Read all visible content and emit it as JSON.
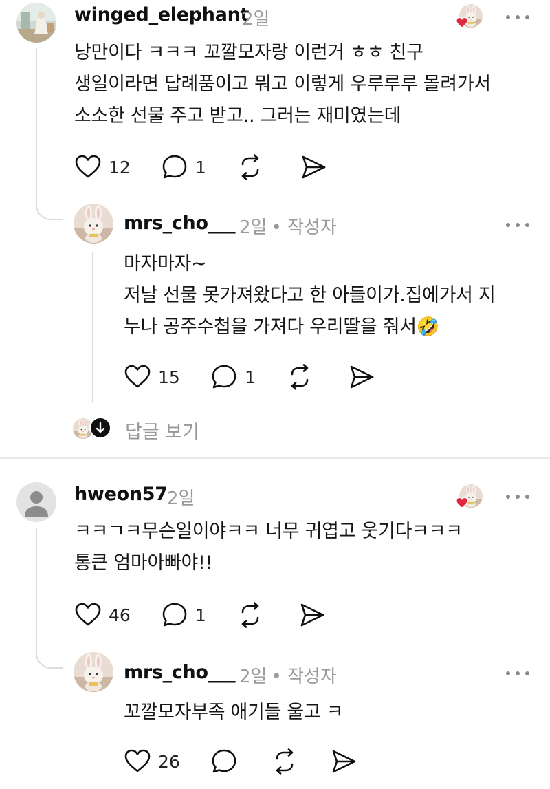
{
  "comments": [
    {
      "username": "winged_elephant",
      "time": "2일",
      "lines": [
        "낭만이다 ㅋㅋㅋ 꼬깔모자랑 이런거 ㅎㅎ 친구",
        "생일이라면 답례품이고 뭐고 이렇게 우루루루 몰려가서",
        "소소한 선물 주고 받고.. 그러는 재미였는데"
      ],
      "likes": "12",
      "replies": "1",
      "reply": {
        "username": "mrs_cho___",
        "time": "2일",
        "author_tag": "• 작성자",
        "lines": [
          "마자마자~",
          "저날 선물 못가져왔다고 한 아들이가.집에가서 지",
          "누나 공주수첩을 가져다 우리딸을 줘서🤣"
        ],
        "likes": "15",
        "replies": "1"
      },
      "view_replies": "답글 보기"
    },
    {
      "username": "hweon57",
      "time": "2일",
      "lines": [
        "ㅋㅋㄱㅋ무슨일이야ㅋㅋ 너무 귀엽고 웃기다ㅋㅋㅋ",
        "통큰 엄마아빠야!!"
      ],
      "likes": "46",
      "replies": "1",
      "reply": {
        "username": "mrs_cho___",
        "time": "2일",
        "author_tag": "• 작성자",
        "lines": [
          "꼬깔모자부족 애기들 울고 ㅋ"
        ],
        "likes": "26",
        "replies": ""
      }
    }
  ],
  "colors": {
    "heart_red": "#e3263b",
    "muted": "#9a9a9a",
    "line": "#dcdcdc"
  },
  "icons": [
    "heart-icon",
    "comment-icon",
    "repost-icon",
    "send-icon",
    "more-icon",
    "arrow-down-icon",
    "liked-by-author-icon"
  ]
}
